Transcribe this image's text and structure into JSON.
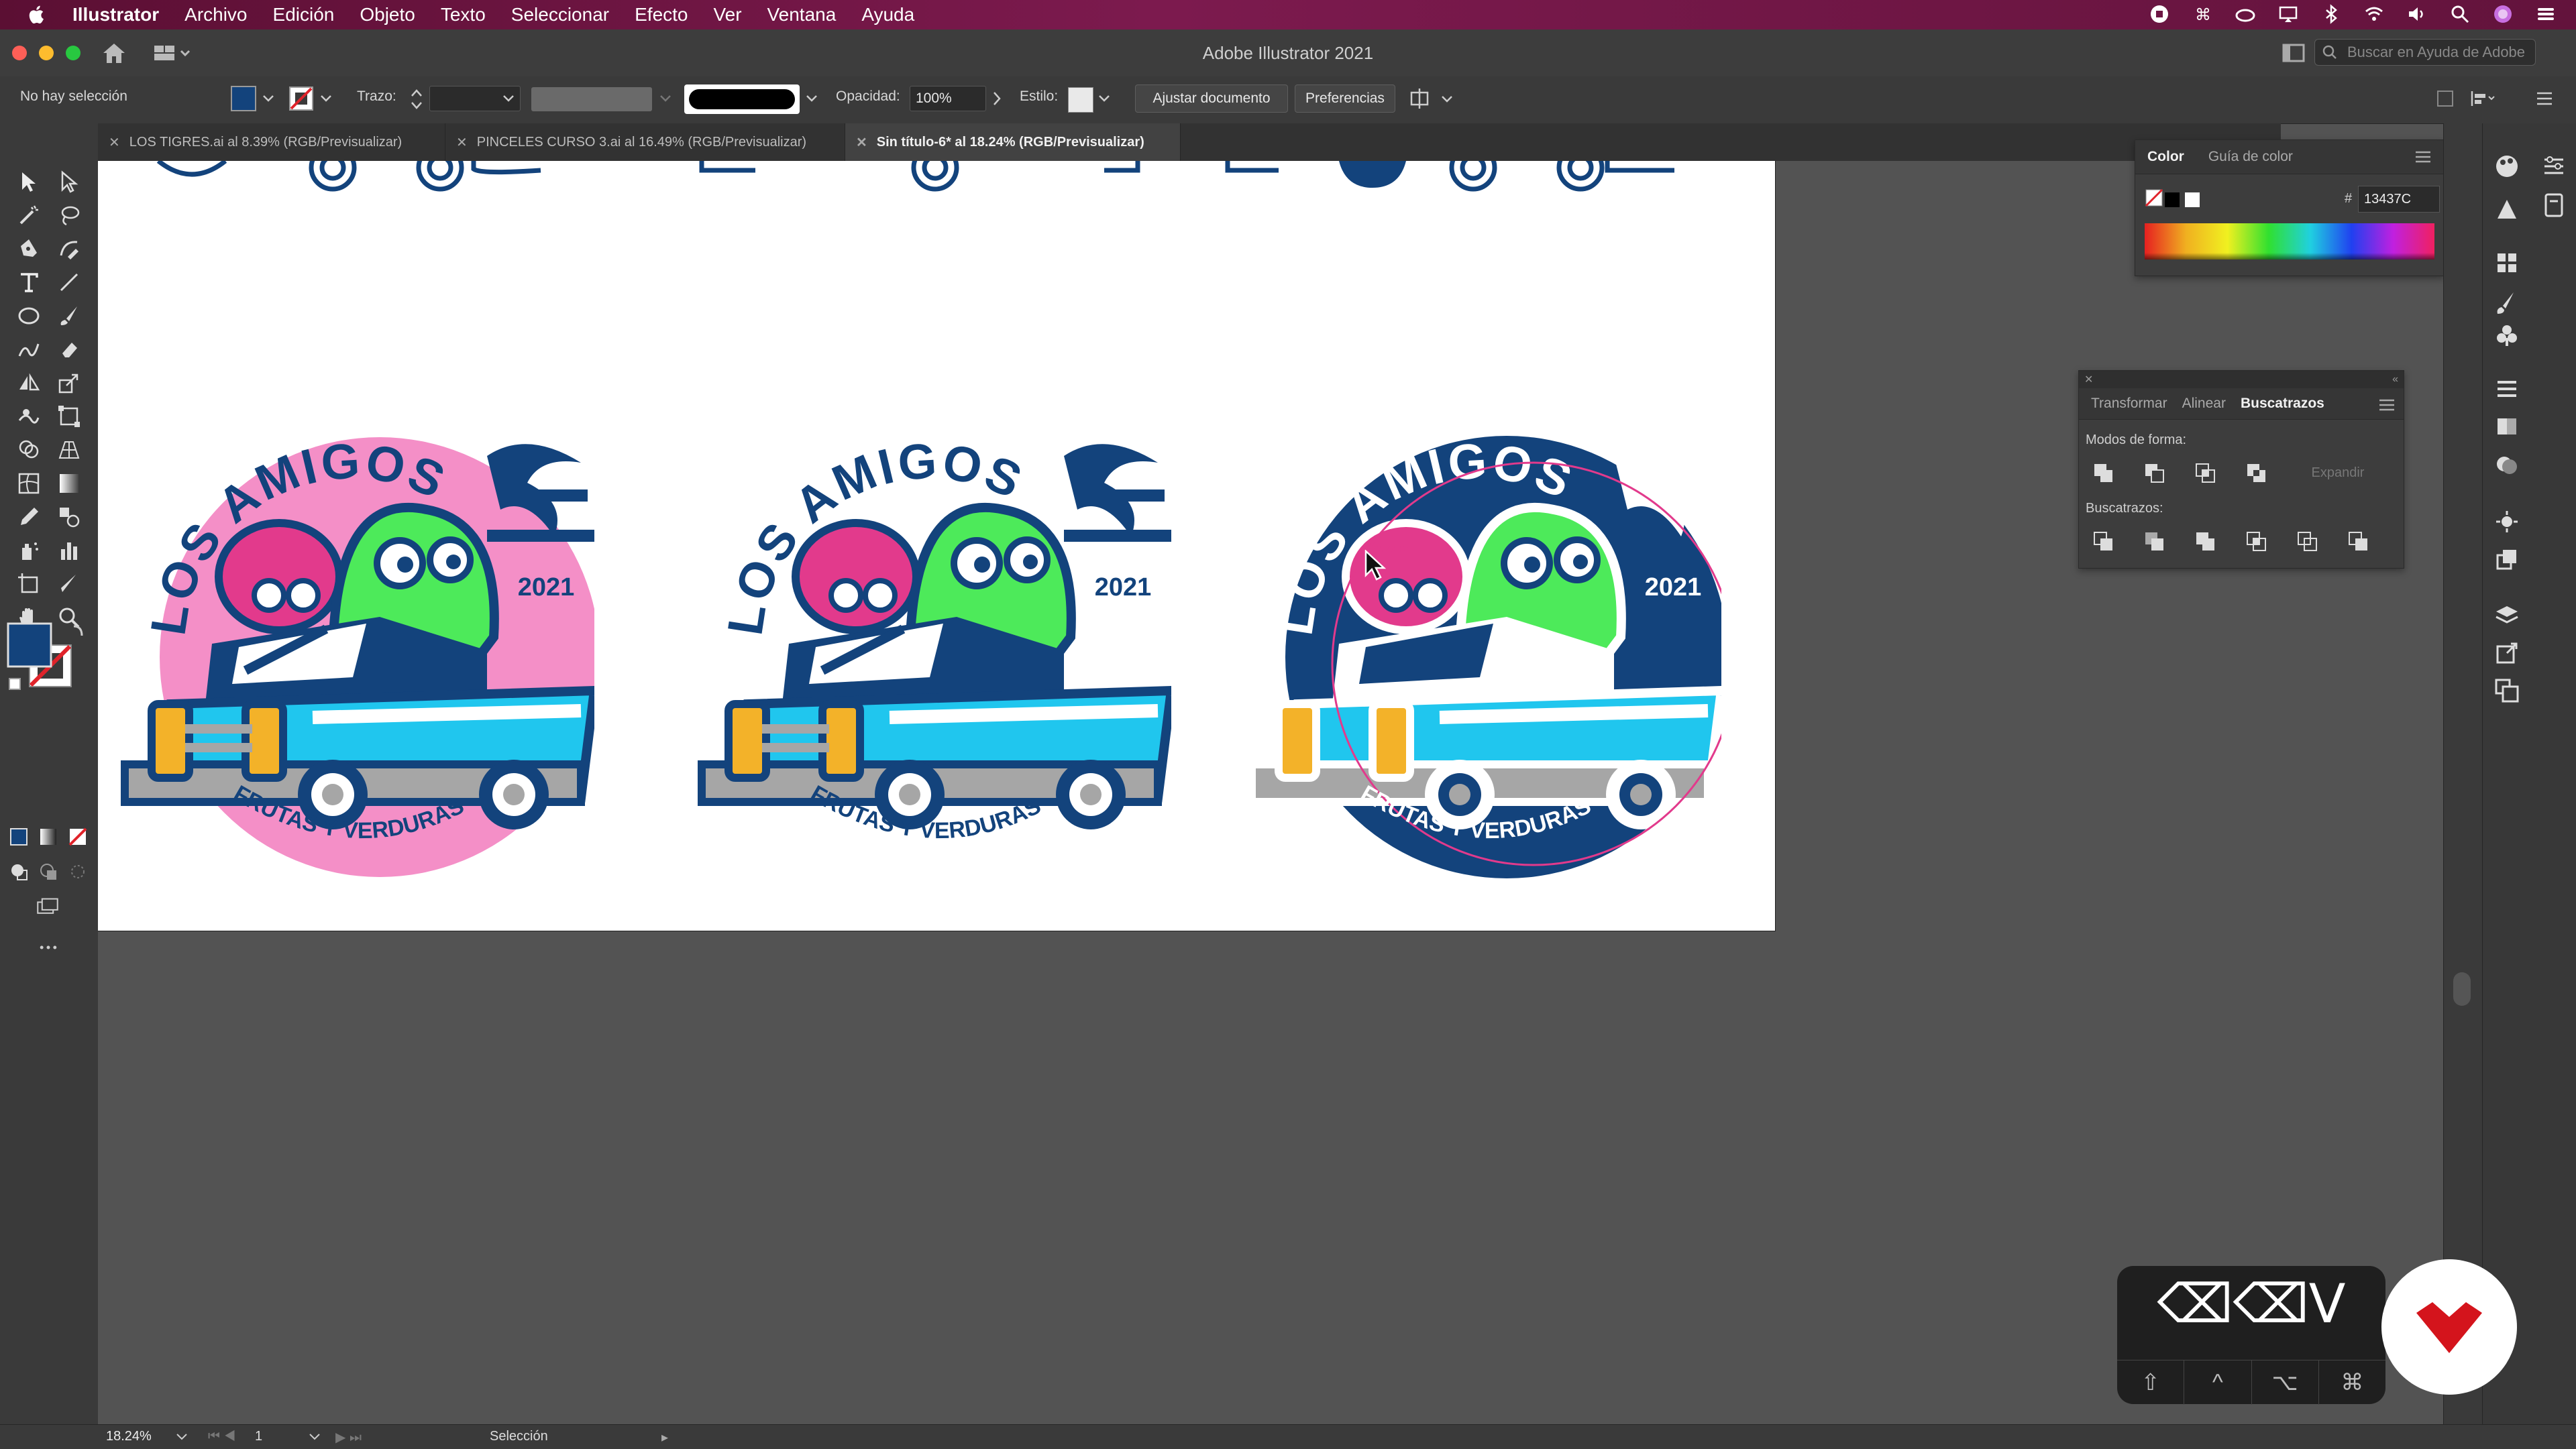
{
  "menubar": {
    "app": "Illustrator",
    "items": [
      "Archivo",
      "Edición",
      "Objeto",
      "Texto",
      "Seleccionar",
      "Efecto",
      "Ver",
      "Ventana",
      "Ayuda"
    ]
  },
  "window": {
    "title": "Adobe Illustrator 2021",
    "search_placeholder": "Buscar en Ayuda de Adobe"
  },
  "control_bar": {
    "selection_status": "No hay selección",
    "stroke_label": "Trazo:",
    "opacity_label": "Opacidad:",
    "opacity_value": "100%",
    "style_label": "Estilo:",
    "fit_document_button": "Ajustar documento",
    "preferences_button": "Preferencias"
  },
  "tabs": [
    {
      "label": "LOS TIGRES.ai al 8.39% (RGB/Previsualizar)",
      "active": false
    },
    {
      "label": "PINCELES CURSO 3.ai al 16.49% (RGB/Previsualizar)",
      "active": false
    },
    {
      "label": "Sin título-6* al 18.24% (RGB/Previsualizar)",
      "active": true
    }
  ],
  "artwork": {
    "title": "LOS AMIGOS",
    "year": "2021",
    "subtitle": "FRUTAS Y VERDURAS",
    "variants": [
      "pink-circle",
      "no-background",
      "navy-circle"
    ],
    "colors": {
      "navy": "#13437C",
      "pink": "#F48FC7",
      "green": "#4DEA5A",
      "cyan": "#20C6EE",
      "magenta": "#E23A8C",
      "grey": "#A6A6A6",
      "amber": "#F3B229"
    }
  },
  "color_panel": {
    "tabs": [
      "Color",
      "Guía de color"
    ],
    "hex_prefix": "#",
    "hex_value": "13437C"
  },
  "pathfinder_panel": {
    "tabs": [
      "Transformar",
      "Alinear",
      "Buscatrazos"
    ],
    "shape_modes_label": "Modos de forma:",
    "expand_button": "Expandir",
    "pathfinders_label": "Buscatrazos:"
  },
  "status_bar": {
    "zoom": "18.24%",
    "artboard_number": "1",
    "tool_name": "Selección"
  },
  "keycast": {
    "keys_shown": "⌫⌫V",
    "modifiers": [
      "⇧",
      "^",
      "⌥",
      "⌘"
    ]
  },
  "fill_color": "#13437C",
  "cursor_hint": "trazado"
}
